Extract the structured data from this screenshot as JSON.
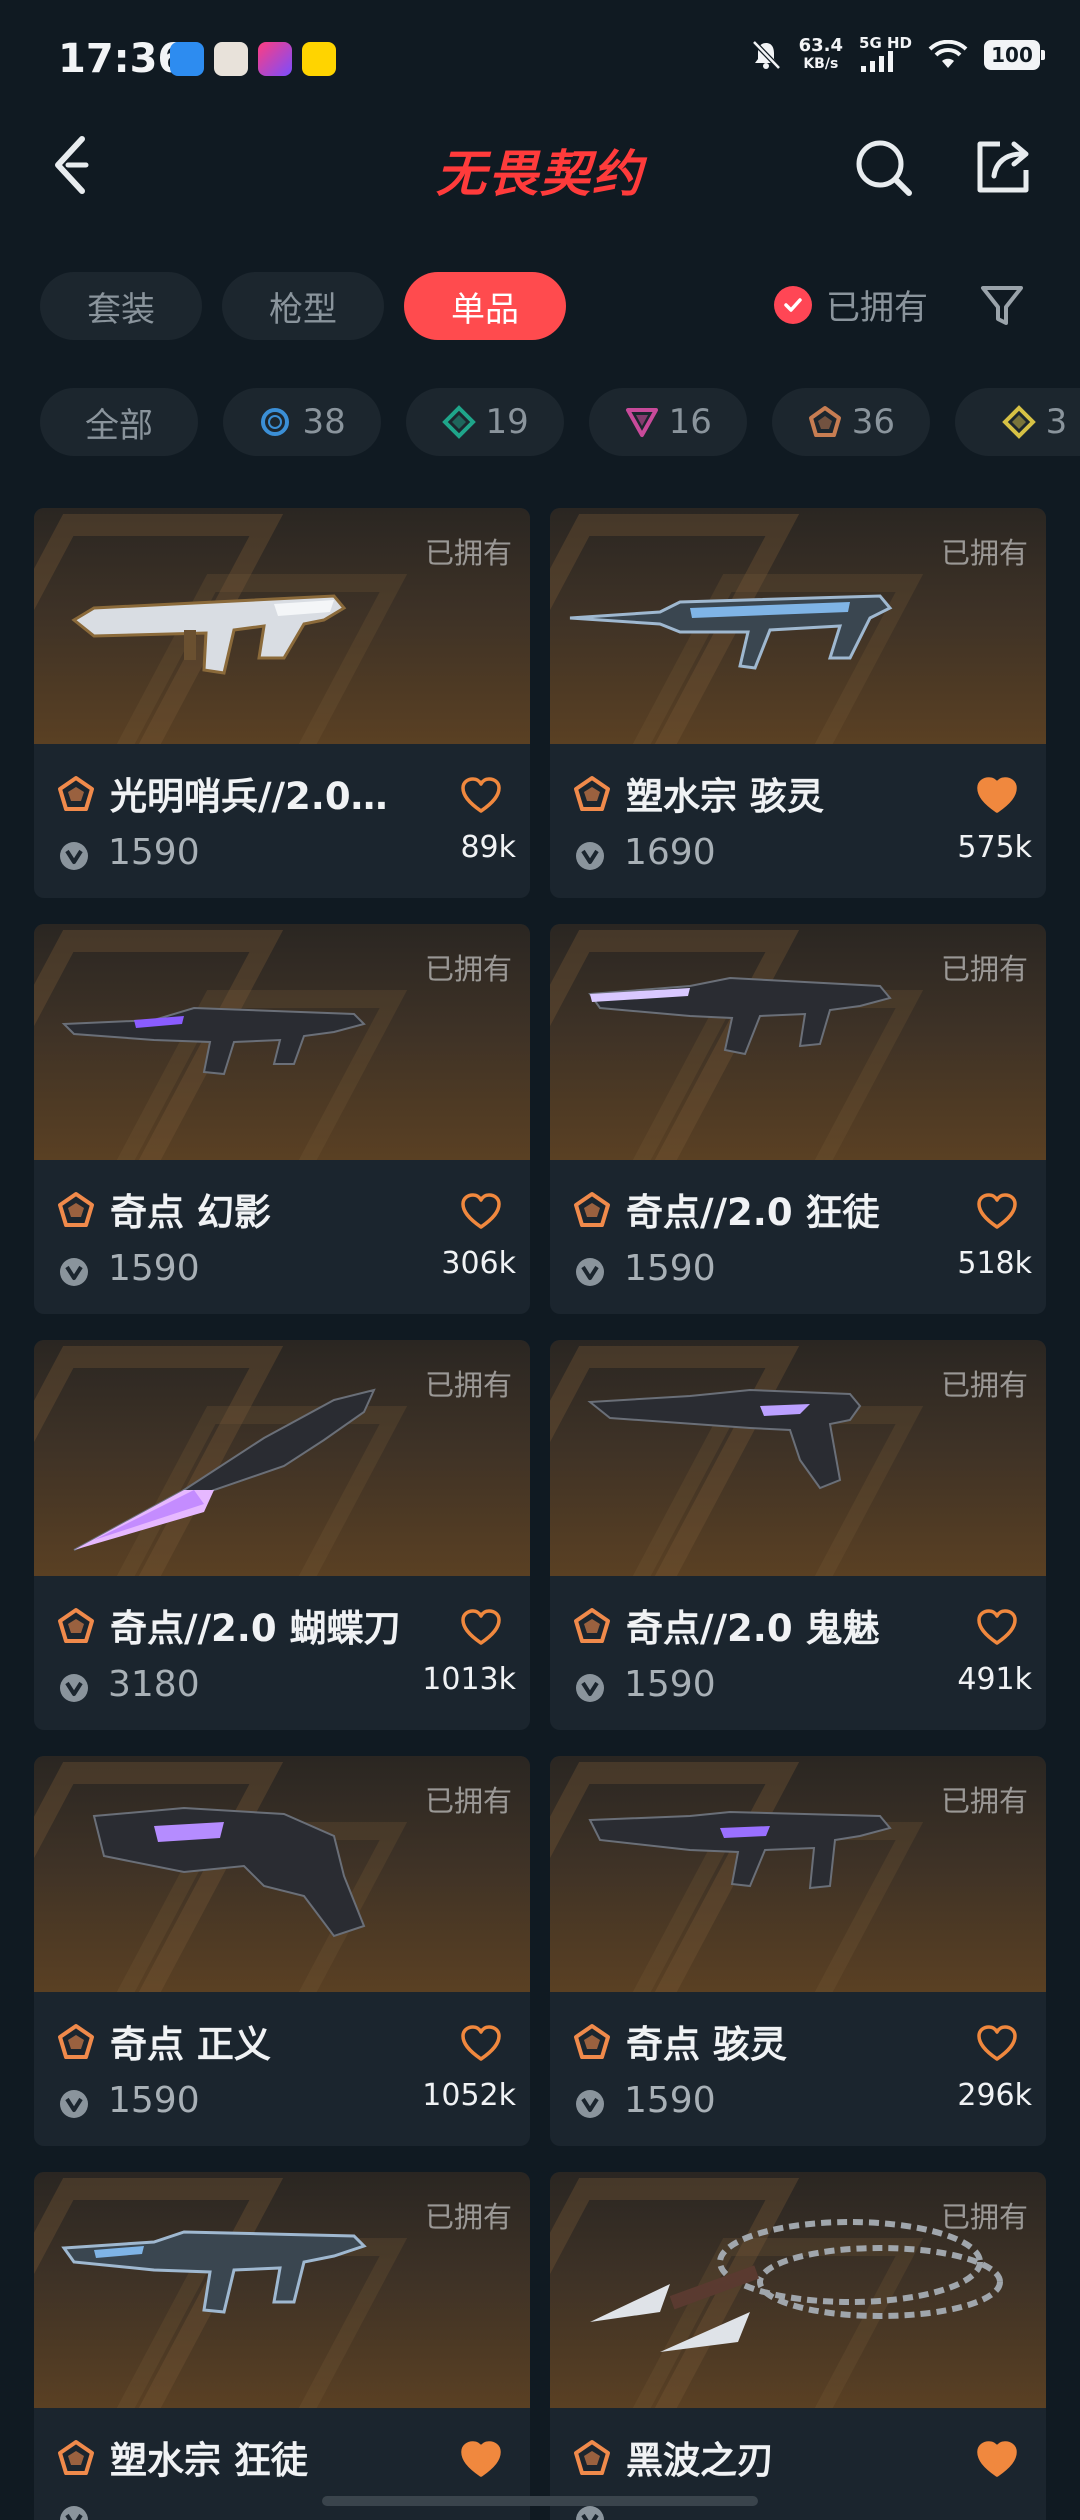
{
  "status_bar": {
    "time": "17:36",
    "net_speed_value": "63.4",
    "net_speed_unit": "KB/s",
    "net_type": "5G HD",
    "battery": "100",
    "app_icons": [
      "qq-icon",
      "avatar-app-icon",
      "video-app-icon",
      "yellow-app-icon"
    ]
  },
  "header": {
    "title": "无畏契约"
  },
  "tabs": [
    {
      "label": "套装",
      "active": false
    },
    {
      "label": "枪型",
      "active": false
    },
    {
      "label": "单品",
      "active": true
    }
  ],
  "owned_filter": {
    "label": "已拥有",
    "checked": true
  },
  "chips": [
    {
      "label": "全部",
      "icon": "",
      "color": ""
    },
    {
      "label": "38",
      "icon": "select-tier-circle-icon",
      "color": "#3b8fd6"
    },
    {
      "label": "19",
      "icon": "deluxe-tier-diamond-icon",
      "color": "#1fa58a"
    },
    {
      "label": "16",
      "icon": "premium-tier-triangle-icon",
      "color": "#c84a9a"
    },
    {
      "label": "36",
      "icon": "exclusive-tier-pentagon-icon",
      "color": "#c77d52"
    },
    {
      "label": "3",
      "icon": "ultra-tier-diamond-icon",
      "color": "#d6c145"
    }
  ],
  "cards": [
    {
      "name": "光明哨兵//2.0…",
      "price": "1590",
      "likes": "89k",
      "owned_label": "已拥有",
      "liked": false,
      "weapon": "silver-rifle"
    },
    {
      "name": "塑水宗 骇灵",
      "price": "1690",
      "likes": "575k",
      "owned_label": "已拥有",
      "liked": true,
      "weapon": "blue-smg"
    },
    {
      "name": "奇点 幻影",
      "price": "1590",
      "likes": "306k",
      "owned_label": "已拥有",
      "liked": false,
      "weapon": "dark-rifle"
    },
    {
      "name": "奇点//2.0 狂徒",
      "price": "1590",
      "likes": "518k",
      "owned_label": "已拥有",
      "liked": false,
      "weapon": "dark-rifle-2"
    },
    {
      "name": "奇点//2.0 蝴蝶刀",
      "price": "3180",
      "likes": "1013k",
      "owned_label": "已拥有",
      "liked": false,
      "weapon": "knife"
    },
    {
      "name": "奇点//2.0 鬼魅",
      "price": "1590",
      "likes": "491k",
      "owned_label": "已拥有",
      "liked": false,
      "weapon": "pistol"
    },
    {
      "name": "奇点 正义",
      "price": "1590",
      "likes": "1052k",
      "owned_label": "已拥有",
      "liked": false,
      "weapon": "revolver"
    },
    {
      "name": "奇点 骇灵",
      "price": "1590",
      "likes": "296k",
      "owned_label": "已拥有",
      "liked": false,
      "weapon": "dark-smg"
    },
    {
      "name": "塑水宗 狂徒",
      "price": "",
      "likes": "",
      "owned_label": "已拥有",
      "liked": true,
      "weapon": "blue-rifle"
    },
    {
      "name": "黑波之刃",
      "price": "",
      "likes": "",
      "owned_label": "已拥有",
      "liked": true,
      "weapon": "kunai"
    }
  ],
  "colors": {
    "accent": "#ff4b4e",
    "heart": "#f0883e",
    "tier_exclusive": "#f08a4b"
  }
}
